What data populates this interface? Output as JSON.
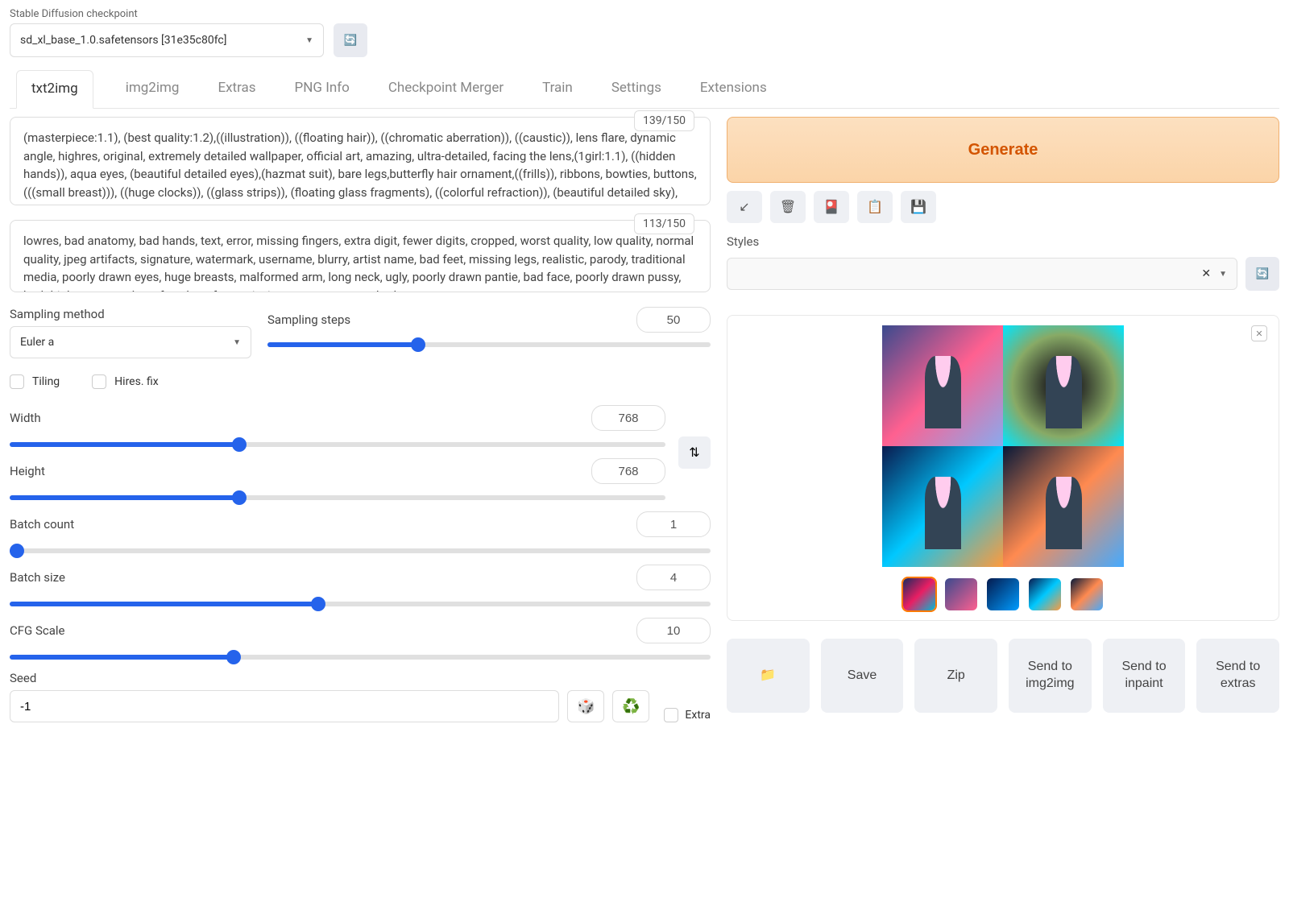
{
  "checkpoint": {
    "label": "Stable Diffusion checkpoint",
    "value": "sd_xl_base_1.0.safetensors [31e35c80fc]"
  },
  "tabs": [
    "txt2img",
    "img2img",
    "Extras",
    "PNG Info",
    "Checkpoint Merger",
    "Train",
    "Settings",
    "Extensions"
  ],
  "prompt": {
    "counter": "139/150",
    "text": "(masterpiece:1.1), (best quality:1.2),((illustration)), ((floating hair)), ((chromatic aberration)), ((caustic)), lens flare, dynamic angle, highres, original, extremely detailed wallpaper, official art, amazing, ultra-detailed, facing the lens,(1girl:1.1), ((hidden hands)), aqua eyes, (beautiful detailed eyes),(hazmat suit), bare legs,butterfly hair ornament,((frills)), ribbons, bowties, buttons, (((small breast))), ((huge clocks)), ((glass strips)), (floating glass fragments), ((colorful refraction)), (beautiful detailed sky), ((dark"
  },
  "neg_prompt": {
    "counter": "113/150",
    "text": "lowres, bad anatomy, bad hands, text, error, missing fingers, extra digit, fewer digits, cropped, worst quality, low quality, normal quality, jpeg artifacts, signature, watermark, username, blurry, artist name, bad feet, missing legs, realistic, parody, traditional media, poorly drawn eyes, huge breasts, malformed arm, long neck, ugly, poorly drawn pantie, bad face, poorly drawn pussy, bad thigh gap, extra legs, futa, long face, missing arms, extra arm, bad_prompt"
  },
  "generate_label": "Generate",
  "styles_label": "Styles",
  "sampling": {
    "method_label": "Sampling method",
    "method_value": "Euler a",
    "steps_label": "Sampling steps",
    "steps_value": "50"
  },
  "checkboxes": {
    "tiling": "Tiling",
    "hires": "Hires. fix",
    "extra": "Extra"
  },
  "dims": {
    "width_label": "Width",
    "width_value": "768",
    "height_label": "Height",
    "height_value": "768"
  },
  "batch": {
    "count_label": "Batch count",
    "count_value": "1",
    "size_label": "Batch size",
    "size_value": "4"
  },
  "cfg": {
    "label": "CFG Scale",
    "value": "10"
  },
  "seed": {
    "label": "Seed",
    "value": "-1"
  },
  "actions": {
    "folder": "📁",
    "save": "Save",
    "zip": "Zip",
    "send_img2img": "Send to img2img",
    "send_inpaint": "Send to inpaint",
    "send_extras": "Send to extras"
  }
}
